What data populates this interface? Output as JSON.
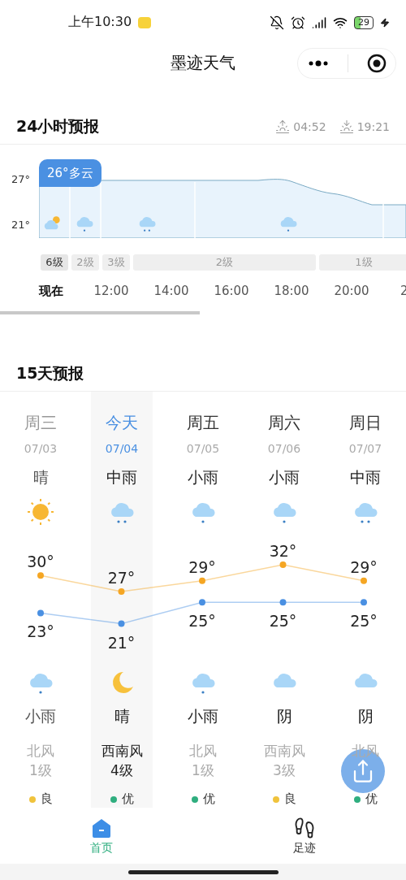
{
  "status_bar": {
    "time": "上午10:30",
    "battery": "29"
  },
  "title_bar": {
    "title": "墨迹天气"
  },
  "hourly": {
    "title": "24小时预报",
    "sunrise": "04:52",
    "sunset": "19:21",
    "current_badge": "26°多云",
    "y_labels": [
      "27°",
      "21°"
    ],
    "icons": [
      {
        "kind": "partly_cloudy"
      },
      {
        "kind": "light_rain"
      },
      {
        "kind": "moderate_rain"
      },
      {
        "kind": "light_rain"
      }
    ],
    "wind": [
      {
        "label": "6级",
        "selected": true
      },
      {
        "label": "2级",
        "selected": false
      },
      {
        "label": "3级",
        "selected": false
      },
      {
        "label": "2级",
        "selected": false
      },
      {
        "label": "1级",
        "selected": false
      }
    ],
    "times": [
      {
        "label": "现在",
        "selected": true
      },
      {
        "label": "12:00",
        "selected": false
      },
      {
        "label": "14:00",
        "selected": false
      },
      {
        "label": "16:00",
        "selected": false
      },
      {
        "label": "18:00",
        "selected": false
      },
      {
        "label": "20:00",
        "selected": false
      },
      {
        "label": "2",
        "selected": false
      }
    ]
  },
  "forecast": {
    "title": "15天预报",
    "days": [
      {
        "weekday": "周三",
        "date": "07/03",
        "day_condition": "晴",
        "day_icon": {
          "kind": "sunny"
        },
        "night_icon": {
          "kind": "light_rain"
        },
        "night_condition": "小雨",
        "wind_dir": "北风",
        "wind_level": "1级",
        "aqi": {
          "label": "良",
          "color": "#f0c33c"
        },
        "past": true,
        "selected": false
      },
      {
        "weekday": "今天",
        "date": "07/04",
        "day_condition": "中雨",
        "day_icon": {
          "kind": "moderate_rain"
        },
        "night_icon": {
          "kind": "moon"
        },
        "night_condition": "晴",
        "wind_dir": "西南风",
        "wind_level": "4级",
        "aqi": {
          "label": "优",
          "color": "#2fae7f"
        },
        "past": false,
        "selected": true
      },
      {
        "weekday": "周五",
        "date": "07/05",
        "day_condition": "小雨",
        "day_icon": {
          "kind": "light_rain"
        },
        "night_icon": {
          "kind": "light_rain"
        },
        "night_condition": "小雨",
        "wind_dir": "北风",
        "wind_level": "1级",
        "aqi": {
          "label": "优",
          "color": "#2fae7f"
        },
        "past": false,
        "selected": false
      },
      {
        "weekday": "周六",
        "date": "07/06",
        "day_condition": "小雨",
        "day_icon": {
          "kind": "light_rain"
        },
        "night_icon": {
          "kind": "overcast"
        },
        "night_condition": "阴",
        "wind_dir": "西南风",
        "wind_level": "3级",
        "aqi": {
          "label": "良",
          "color": "#f0c33c"
        },
        "past": false,
        "selected": false
      },
      {
        "weekday": "周日",
        "date": "07/07",
        "day_condition": "中雨",
        "day_icon": {
          "kind": "moderate_rain"
        },
        "night_icon": {
          "kind": "overcast"
        },
        "night_condition": "阴",
        "wind_dir": "北风",
        "aqi": {
          "label": "优",
          "color": "#2fae7f"
        },
        "past": false,
        "selected": false
      }
    ],
    "chart_data": {
      "type": "line",
      "data_labels": true,
      "series": [
        {
          "color": "#f5a623",
          "marker": true,
          "values": [
            30,
            27,
            29,
            32,
            29
          ],
          "value_labels": [
            "30°",
            "27°",
            "29°",
            "32°",
            "29°"
          ]
        },
        {
          "color": "#4a90e2",
          "marker": true,
          "values": [
            23,
            21,
            25,
            25,
            25
          ],
          "value_labels": [
            "23°",
            "21°",
            "25°",
            "25°",
            "25°"
          ]
        }
      ]
    }
  },
  "tab_bar": [
    {
      "label": "首页",
      "selected": true
    },
    {
      "label": "足迹",
      "selected": false
    }
  ]
}
